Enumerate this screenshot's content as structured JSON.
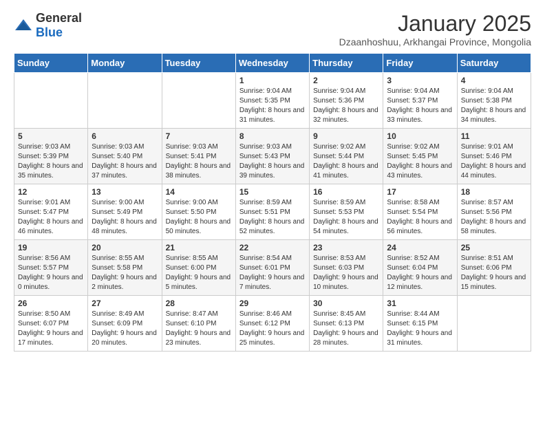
{
  "header": {
    "logo_general": "General",
    "logo_blue": "Blue",
    "month_title": "January 2025",
    "subtitle": "Dzaanhoshuu, Arkhangai Province, Mongolia"
  },
  "days_of_week": [
    "Sunday",
    "Monday",
    "Tuesday",
    "Wednesday",
    "Thursday",
    "Friday",
    "Saturday"
  ],
  "weeks": [
    [
      {
        "day": "",
        "sunrise": "",
        "sunset": "",
        "daylight": ""
      },
      {
        "day": "",
        "sunrise": "",
        "sunset": "",
        "daylight": ""
      },
      {
        "day": "",
        "sunrise": "",
        "sunset": "",
        "daylight": ""
      },
      {
        "day": "1",
        "sunrise": "Sunrise: 9:04 AM",
        "sunset": "Sunset: 5:35 PM",
        "daylight": "Daylight: 8 hours and 31 minutes."
      },
      {
        "day": "2",
        "sunrise": "Sunrise: 9:04 AM",
        "sunset": "Sunset: 5:36 PM",
        "daylight": "Daylight: 8 hours and 32 minutes."
      },
      {
        "day": "3",
        "sunrise": "Sunrise: 9:04 AM",
        "sunset": "Sunset: 5:37 PM",
        "daylight": "Daylight: 8 hours and 33 minutes."
      },
      {
        "day": "4",
        "sunrise": "Sunrise: 9:04 AM",
        "sunset": "Sunset: 5:38 PM",
        "daylight": "Daylight: 8 hours and 34 minutes."
      }
    ],
    [
      {
        "day": "5",
        "sunrise": "Sunrise: 9:03 AM",
        "sunset": "Sunset: 5:39 PM",
        "daylight": "Daylight: 8 hours and 35 minutes."
      },
      {
        "day": "6",
        "sunrise": "Sunrise: 9:03 AM",
        "sunset": "Sunset: 5:40 PM",
        "daylight": "Daylight: 8 hours and 37 minutes."
      },
      {
        "day": "7",
        "sunrise": "Sunrise: 9:03 AM",
        "sunset": "Sunset: 5:41 PM",
        "daylight": "Daylight: 8 hours and 38 minutes."
      },
      {
        "day": "8",
        "sunrise": "Sunrise: 9:03 AM",
        "sunset": "Sunset: 5:43 PM",
        "daylight": "Daylight: 8 hours and 39 minutes."
      },
      {
        "day": "9",
        "sunrise": "Sunrise: 9:02 AM",
        "sunset": "Sunset: 5:44 PM",
        "daylight": "Daylight: 8 hours and 41 minutes."
      },
      {
        "day": "10",
        "sunrise": "Sunrise: 9:02 AM",
        "sunset": "Sunset: 5:45 PM",
        "daylight": "Daylight: 8 hours and 43 minutes."
      },
      {
        "day": "11",
        "sunrise": "Sunrise: 9:01 AM",
        "sunset": "Sunset: 5:46 PM",
        "daylight": "Daylight: 8 hours and 44 minutes."
      }
    ],
    [
      {
        "day": "12",
        "sunrise": "Sunrise: 9:01 AM",
        "sunset": "Sunset: 5:47 PM",
        "daylight": "Daylight: 8 hours and 46 minutes."
      },
      {
        "day": "13",
        "sunrise": "Sunrise: 9:00 AM",
        "sunset": "Sunset: 5:49 PM",
        "daylight": "Daylight: 8 hours and 48 minutes."
      },
      {
        "day": "14",
        "sunrise": "Sunrise: 9:00 AM",
        "sunset": "Sunset: 5:50 PM",
        "daylight": "Daylight: 8 hours and 50 minutes."
      },
      {
        "day": "15",
        "sunrise": "Sunrise: 8:59 AM",
        "sunset": "Sunset: 5:51 PM",
        "daylight": "Daylight: 8 hours and 52 minutes."
      },
      {
        "day": "16",
        "sunrise": "Sunrise: 8:59 AM",
        "sunset": "Sunset: 5:53 PM",
        "daylight": "Daylight: 8 hours and 54 minutes."
      },
      {
        "day": "17",
        "sunrise": "Sunrise: 8:58 AM",
        "sunset": "Sunset: 5:54 PM",
        "daylight": "Daylight: 8 hours and 56 minutes."
      },
      {
        "day": "18",
        "sunrise": "Sunrise: 8:57 AM",
        "sunset": "Sunset: 5:56 PM",
        "daylight": "Daylight: 8 hours and 58 minutes."
      }
    ],
    [
      {
        "day": "19",
        "sunrise": "Sunrise: 8:56 AM",
        "sunset": "Sunset: 5:57 PM",
        "daylight": "Daylight: 9 hours and 0 minutes."
      },
      {
        "day": "20",
        "sunrise": "Sunrise: 8:55 AM",
        "sunset": "Sunset: 5:58 PM",
        "daylight": "Daylight: 9 hours and 2 minutes."
      },
      {
        "day": "21",
        "sunrise": "Sunrise: 8:55 AM",
        "sunset": "Sunset: 6:00 PM",
        "daylight": "Daylight: 9 hours and 5 minutes."
      },
      {
        "day": "22",
        "sunrise": "Sunrise: 8:54 AM",
        "sunset": "Sunset: 6:01 PM",
        "daylight": "Daylight: 9 hours and 7 minutes."
      },
      {
        "day": "23",
        "sunrise": "Sunrise: 8:53 AM",
        "sunset": "Sunset: 6:03 PM",
        "daylight": "Daylight: 9 hours and 10 minutes."
      },
      {
        "day": "24",
        "sunrise": "Sunrise: 8:52 AM",
        "sunset": "Sunset: 6:04 PM",
        "daylight": "Daylight: 9 hours and 12 minutes."
      },
      {
        "day": "25",
        "sunrise": "Sunrise: 8:51 AM",
        "sunset": "Sunset: 6:06 PM",
        "daylight": "Daylight: 9 hours and 15 minutes."
      }
    ],
    [
      {
        "day": "26",
        "sunrise": "Sunrise: 8:50 AM",
        "sunset": "Sunset: 6:07 PM",
        "daylight": "Daylight: 9 hours and 17 minutes."
      },
      {
        "day": "27",
        "sunrise": "Sunrise: 8:49 AM",
        "sunset": "Sunset: 6:09 PM",
        "daylight": "Daylight: 9 hours and 20 minutes."
      },
      {
        "day": "28",
        "sunrise": "Sunrise: 8:47 AM",
        "sunset": "Sunset: 6:10 PM",
        "daylight": "Daylight: 9 hours and 23 minutes."
      },
      {
        "day": "29",
        "sunrise": "Sunrise: 8:46 AM",
        "sunset": "Sunset: 6:12 PM",
        "daylight": "Daylight: 9 hours and 25 minutes."
      },
      {
        "day": "30",
        "sunrise": "Sunrise: 8:45 AM",
        "sunset": "Sunset: 6:13 PM",
        "daylight": "Daylight: 9 hours and 28 minutes."
      },
      {
        "day": "31",
        "sunrise": "Sunrise: 8:44 AM",
        "sunset": "Sunset: 6:15 PM",
        "daylight": "Daylight: 9 hours and 31 minutes."
      },
      {
        "day": "",
        "sunrise": "",
        "sunset": "",
        "daylight": ""
      }
    ]
  ]
}
